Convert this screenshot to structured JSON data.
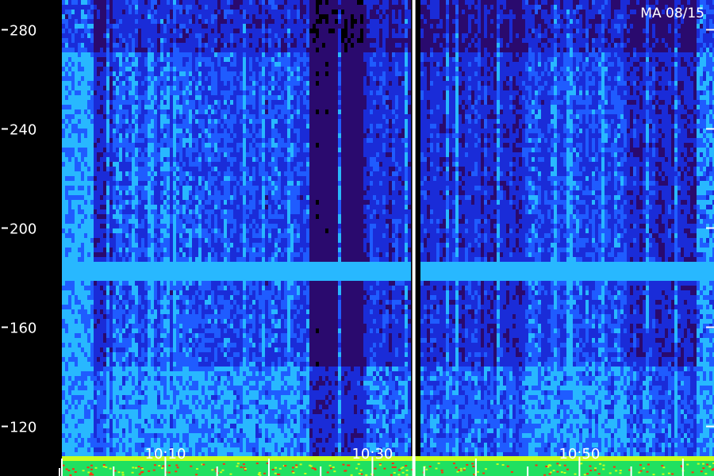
{
  "chart_data": {
    "type": "heatmap",
    "title": "",
    "station_date": "MA 08/15",
    "xlabel": "",
    "ylabel": "",
    "y_ticks": [
      120,
      160,
      200,
      240,
      280
    ],
    "y_tick_labels": [
      "120",
      "160",
      "200",
      "240",
      "280"
    ],
    "ylim": [
      100,
      292
    ],
    "x_tick_labels": [
      "10:10",
      "10:30",
      "10:50"
    ],
    "x_ticks_minutes": [
      10,
      30,
      50
    ],
    "xlim_minutes": [
      0,
      63
    ],
    "colormap": [
      "#000000",
      "#2a0a6e",
      "#1a2cd8",
      "#1f5cff",
      "#28b8ff",
      "#c8ff20",
      "#20e060",
      "#ff3010"
    ],
    "highlight_band": {
      "y": [
        180,
        186
      ]
    },
    "gap_minute": 34.0,
    "grid": false,
    "legend": "none"
  }
}
